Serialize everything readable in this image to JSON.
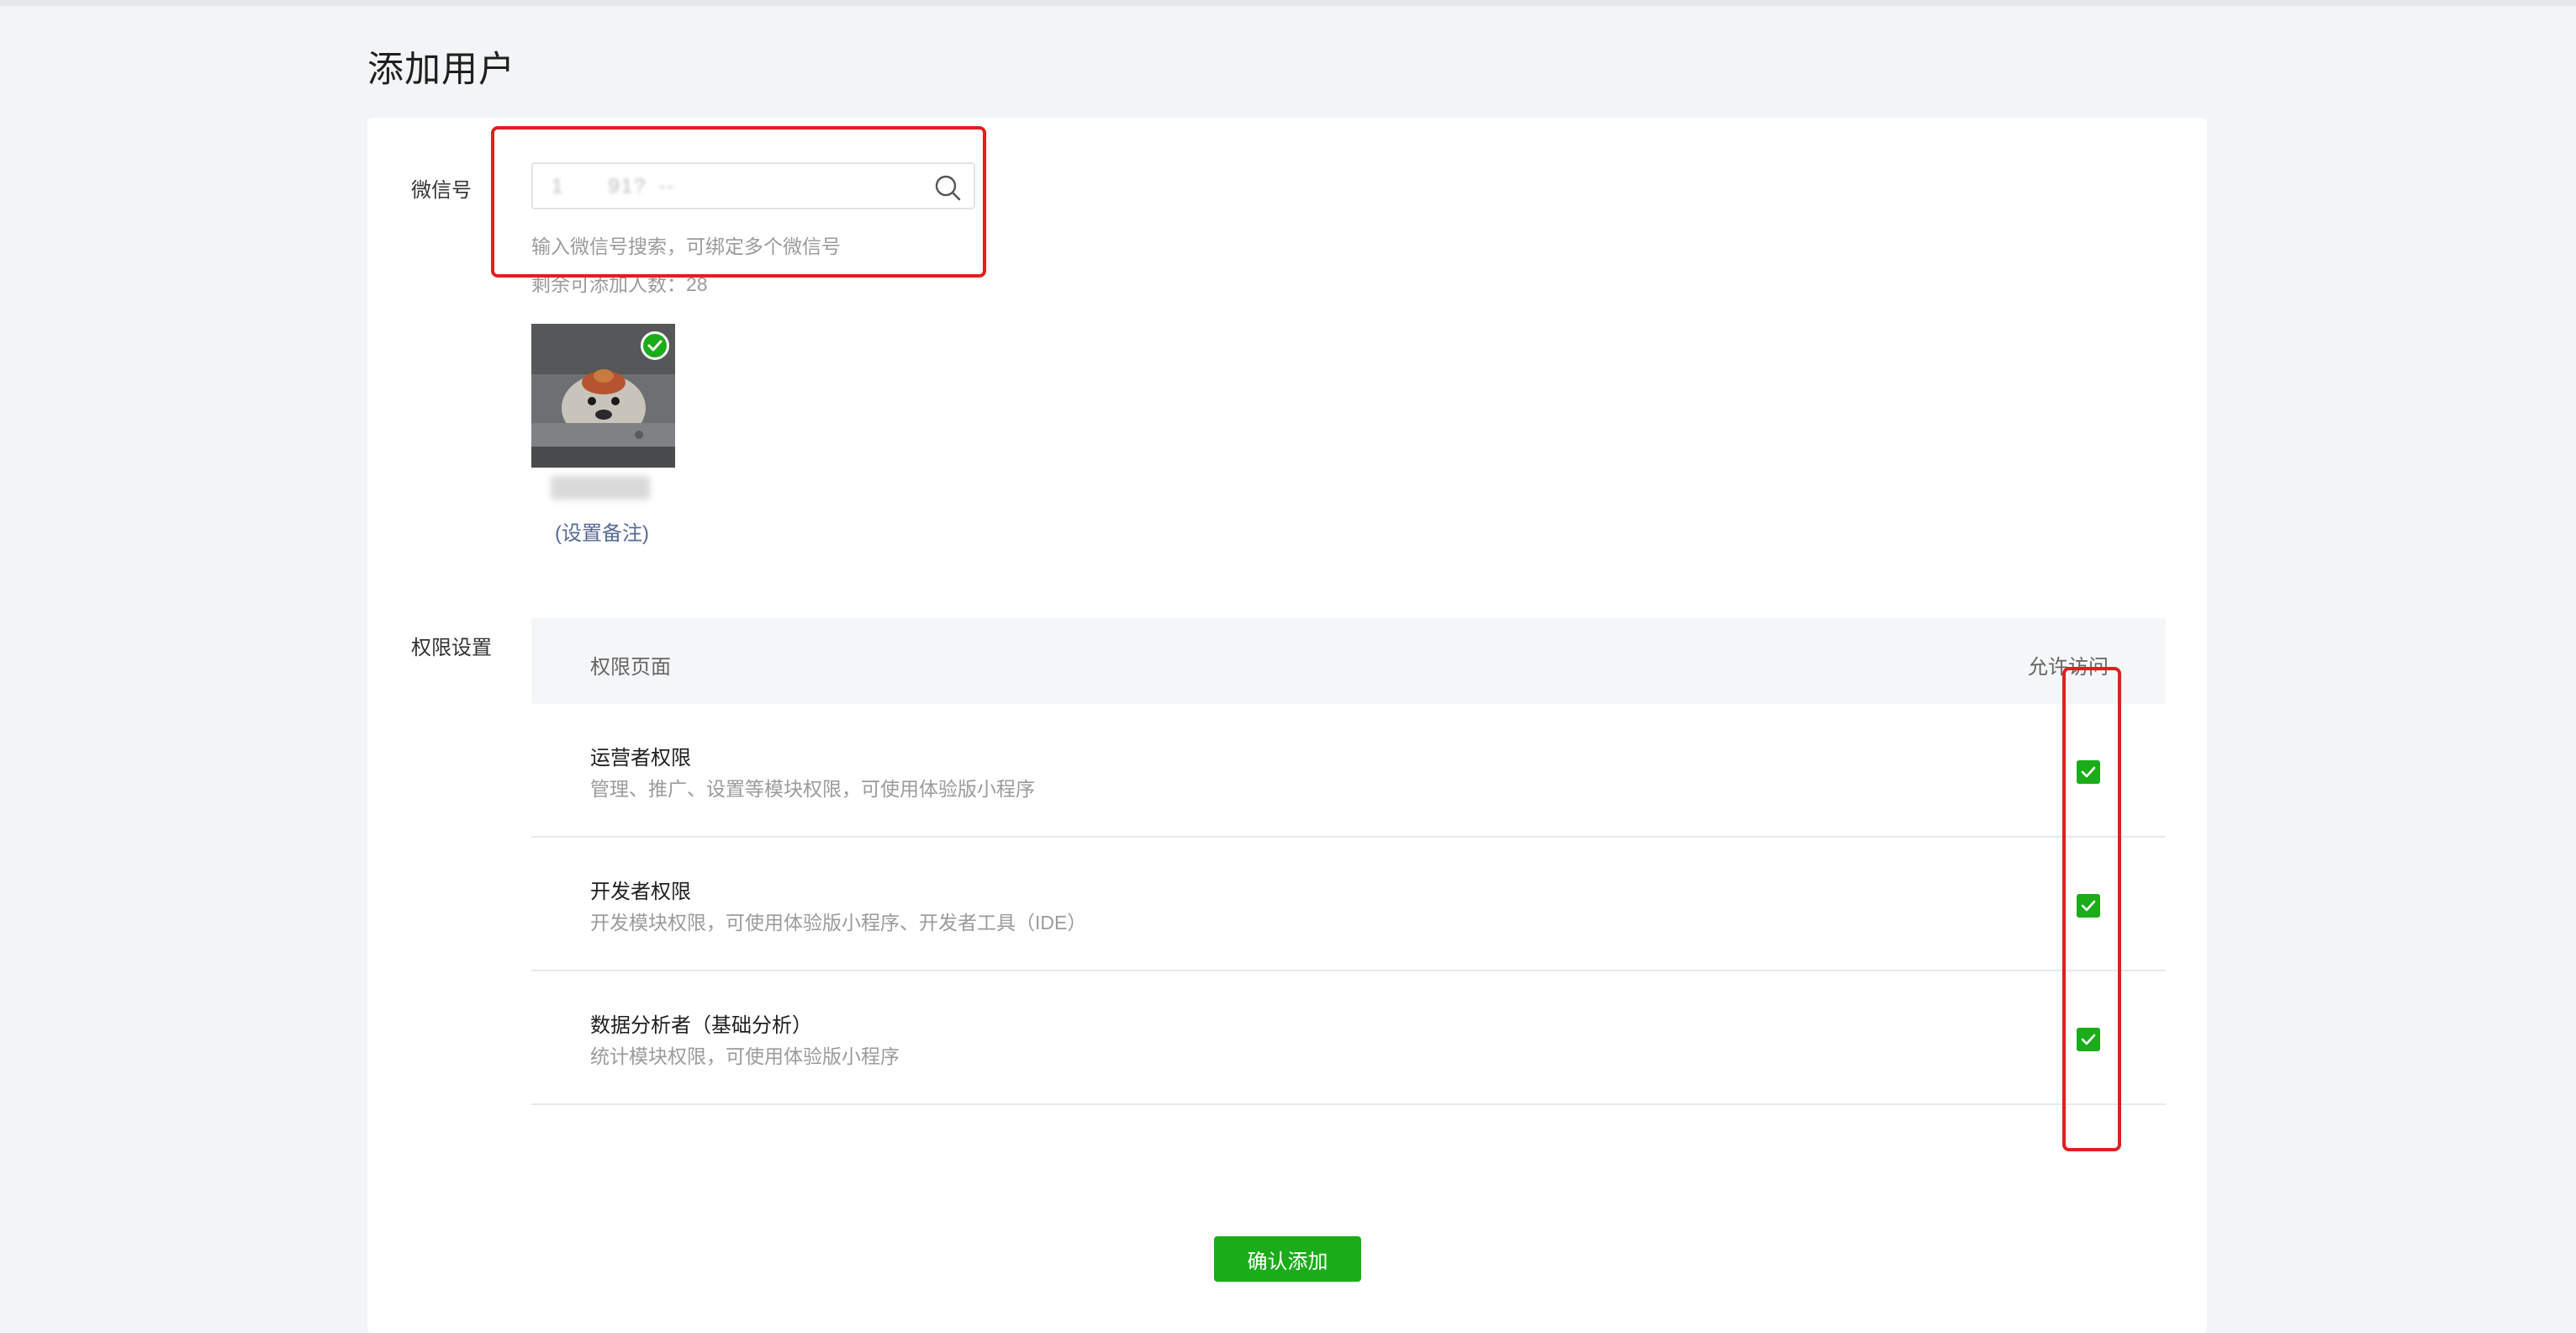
{
  "page": {
    "title": "添加用户"
  },
  "wechat": {
    "label": "微信号",
    "search_value": "1  91? --",
    "hint": "输入微信号搜索，可绑定多个微信号",
    "remaining": "剩余可添加人数：28",
    "set_remark": "(设置备注)"
  },
  "permissions": {
    "label": "权限设置",
    "col_page": "权限页面",
    "col_allow": "允许访问",
    "rows": [
      {
        "title": "运营者权限",
        "desc": "管理、推广、设置等模块权限，可使用体验版小程序",
        "checked": true
      },
      {
        "title": "开发者权限",
        "desc": "开发模块权限，可使用体验版小程序、开发者工具（IDE）",
        "checked": true
      },
      {
        "title": "数据分析者（基础分析）",
        "desc": "统计模块权限，可使用体验版小程序",
        "checked": true
      }
    ]
  },
  "confirm_label": "确认添加",
  "colors": {
    "accent": "#1aad19",
    "annotation": "#e01f1f",
    "link": "#576b95"
  }
}
